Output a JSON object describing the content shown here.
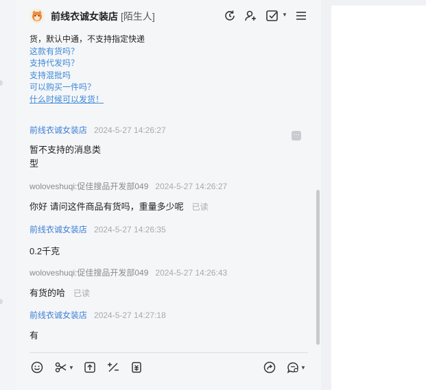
{
  "header": {
    "shop_name": "前线衣诚女装店",
    "tag": "[陌生人]",
    "icons": [
      "history-icon",
      "add-contact-icon",
      "task-check-icon",
      "menu-icon"
    ]
  },
  "messages": {
    "top_partial": {
      "cut_line": "……………………………………………………",
      "last_line": "货，默认中通，不支持指定快递",
      "links": [
        "这款有货吗？",
        "支持代发吗？",
        "支持混批吗",
        "可以购买一件吗？",
        "什么时候可以发货！"
      ]
    },
    "items": [
      {
        "sender": "前线衣诚女装店",
        "time": "2024-5-27 14:26:27",
        "lines": [
          "暂不支持的消息类",
          "型"
        ],
        "read": ""
      },
      {
        "sender": "woloveshuqi:促佳搜品开发部049",
        "time": "2024-5-27 14:26:27",
        "lines": [
          "你好 请问这件商品有货吗，重量多少呢"
        ],
        "read": "已读"
      },
      {
        "sender": "前线衣诚女装店",
        "time": "2024-5-27 14:26:35",
        "lines": [
          "0.2千克"
        ],
        "read": ""
      },
      {
        "sender": "woloveshuqi:促佳搜品开发部049",
        "time": "2024-5-27 14:26:43",
        "lines": [
          "有货的哈"
        ],
        "read": "已读"
      },
      {
        "sender": "前线衣诚女装店",
        "time": "2024-5-27 14:27:18",
        "lines": [
          "有"
        ],
        "read": ""
      }
    ]
  },
  "toolbar": {
    "icons": [
      "emoji-icon",
      "scissors-icon",
      "upload-icon",
      "discount-icon",
      "order-icon",
      "share-icon",
      "quick-reply-icon"
    ]
  },
  "colors": {
    "link": "#3d8ad8",
    "shop_name": "#3d7fd6",
    "time": "#a9a9a9"
  }
}
